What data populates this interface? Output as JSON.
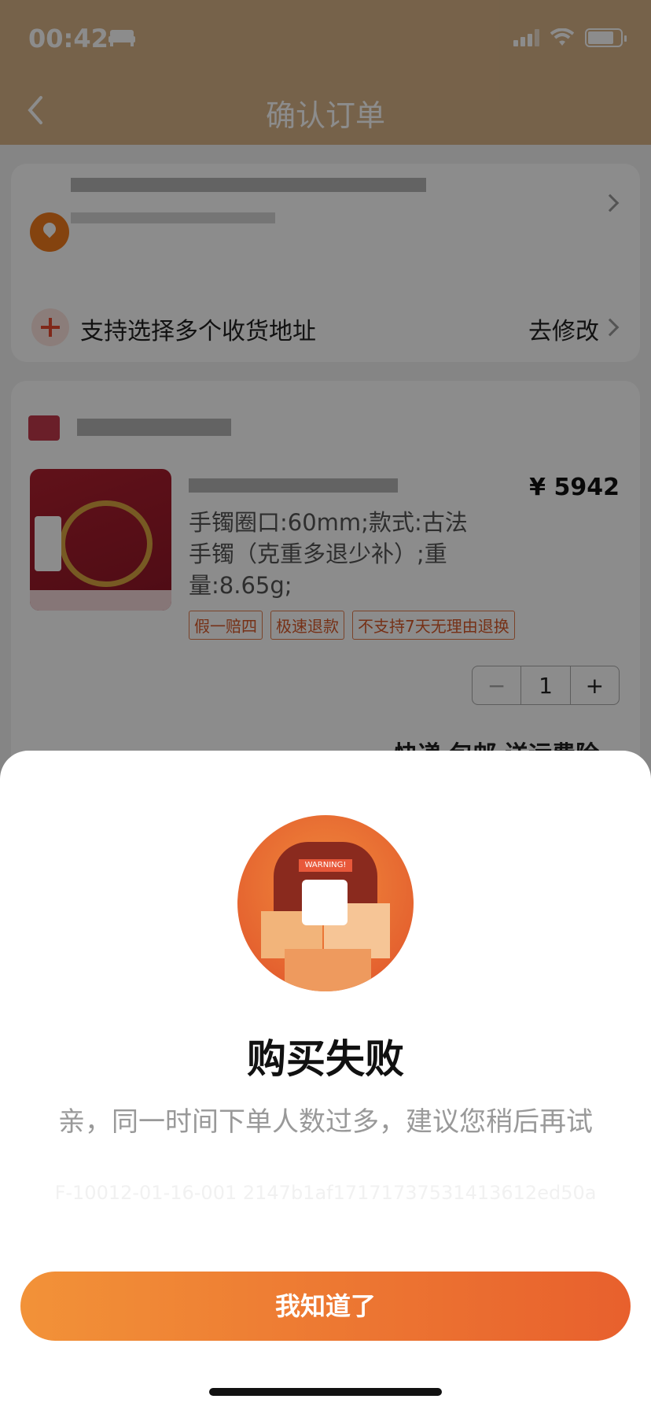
{
  "status_bar": {
    "time": "00:42"
  },
  "header": {
    "title": "确认订单"
  },
  "address": {
    "multi_label": "支持选择多个收货地址",
    "edit_label": "去修改"
  },
  "product": {
    "price": "¥ 5942",
    "spec": "手镯圈口:60mm;款式:古法手镯（克重多退少补）;重量:8.65g;",
    "badges": [
      "假一赔四",
      "极速退款",
      "不支持7天无理由退换"
    ],
    "quantity": "1",
    "shipping": "快递 包邮 送运费险"
  },
  "dialog": {
    "title": "购买失败",
    "message": "亲，同一时间下单人数过多，建议您稍后再试",
    "trace_id": "F-10012-01-16-001 2147b1af17171737531413612ed50a",
    "confirm_label": "我知道了",
    "illustration_text": "WARNING!"
  },
  "colors": {
    "accent": "#e8602d",
    "header": "#d8b287"
  }
}
